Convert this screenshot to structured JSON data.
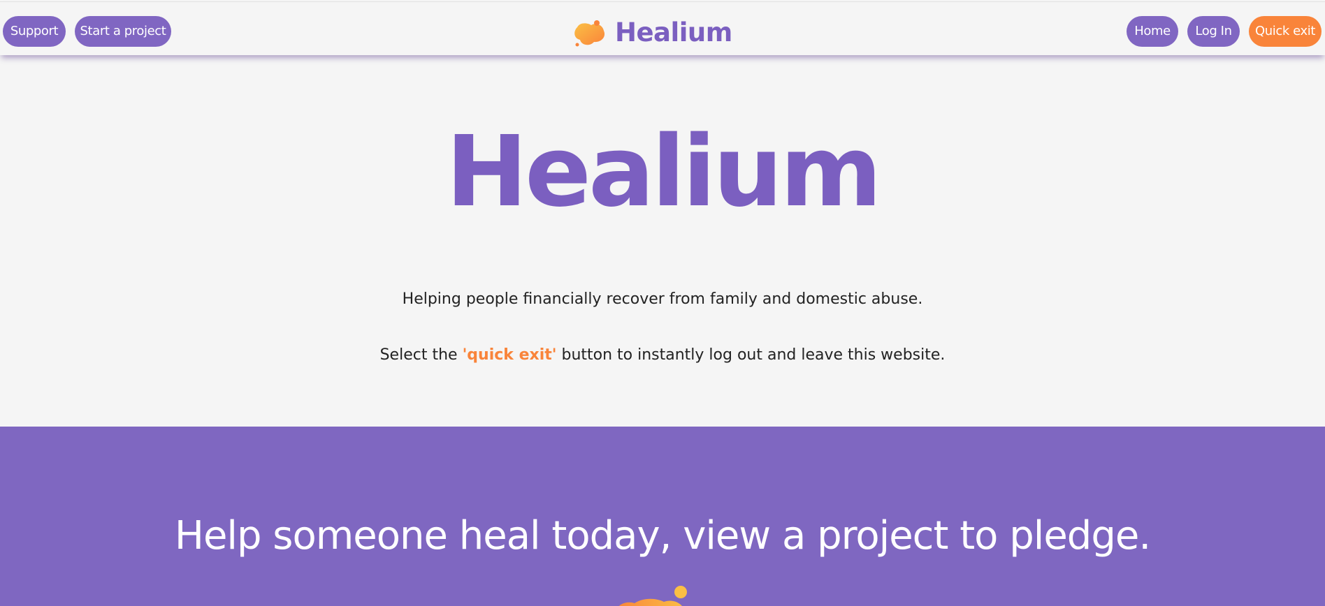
{
  "nav": {
    "support_label": "Support",
    "start_project_label": "Start a project",
    "home_label": "Home",
    "login_label": "Log In",
    "quick_exit_label": "Quick exit"
  },
  "brand": {
    "name": "Healium",
    "logo_icon": "blob-logo-icon"
  },
  "hero": {
    "title": "Healium",
    "tagline": "Helping people financially recover from family and domestic abuse.",
    "exit_note_prefix": "Select the ",
    "exit_note_highlight": "'quick exit'",
    "exit_note_suffix": " button to instantly log out and leave this website."
  },
  "pledge_band": {
    "heading": "Help someone heal today, view a project to pledge."
  },
  "colors": {
    "primary_purple": "#7b5fc0",
    "band_purple": "#7f67c1",
    "accent_orange": "#f9843a",
    "logo_yellow": "#fbbf45",
    "background": "#f5f5f5"
  }
}
